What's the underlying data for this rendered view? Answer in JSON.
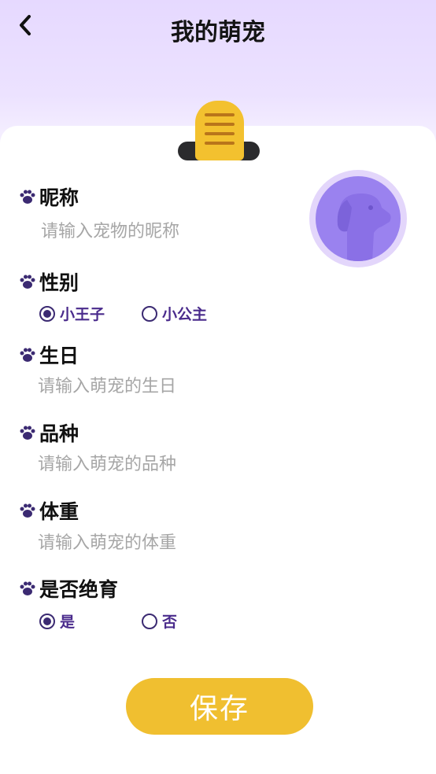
{
  "header": {
    "title": "我的萌宠"
  },
  "fields": {
    "nickname": {
      "label": "昵称",
      "placeholder": "请输入宠物的昵称"
    },
    "gender": {
      "label": "性别",
      "options": [
        "小王子",
        "小公主"
      ],
      "selected": "小王子"
    },
    "birthday": {
      "label": "生日",
      "placeholder": "请输入萌宠的生日"
    },
    "breed": {
      "label": "品种",
      "placeholder": "请输入萌宠的品种"
    },
    "weight": {
      "label": "体重",
      "placeholder": "请输入萌宠的体重"
    },
    "neutered": {
      "label": "是否绝育",
      "options": [
        "是",
        "否"
      ],
      "selected": "是"
    }
  },
  "actions": {
    "save_label": "保存"
  },
  "icons": {
    "back": "back-arrow-icon",
    "paw": "paw-icon",
    "avatar": "dog-icon",
    "clip": "clipboard-clip-icon"
  },
  "colors": {
    "accent_yellow": "#f0bf30",
    "purple_dark": "#3b2a72",
    "avatar_purple": "#9a82ef",
    "header_bg": "#e6d9ff"
  }
}
